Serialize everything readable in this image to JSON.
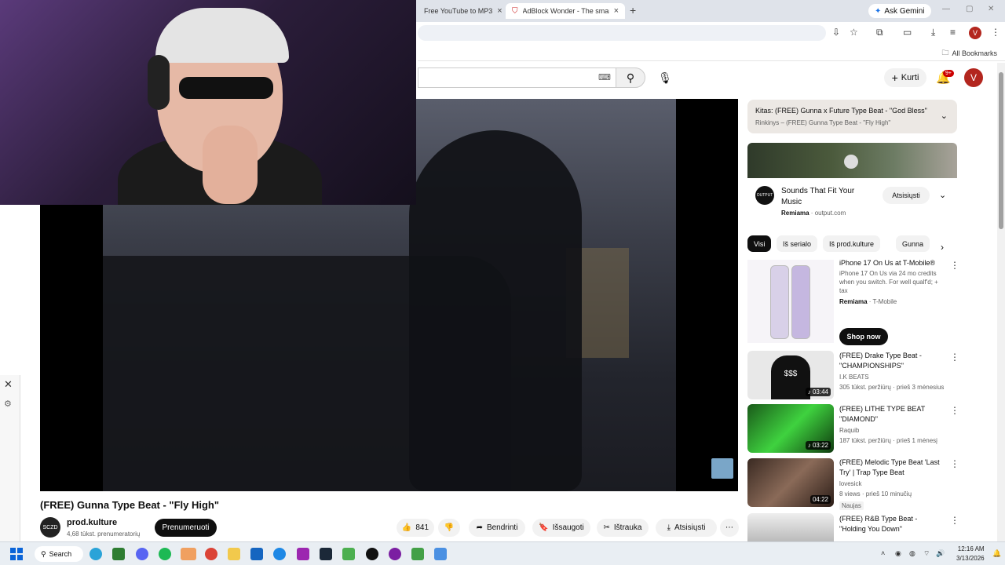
{
  "browser": {
    "tabs": [
      {
        "label": "Free YouTube to MP3"
      },
      {
        "label": "AdBlock Wonder - The smartest"
      }
    ],
    "ask_gemini": "Ask Gemini",
    "profile_initial": "V",
    "all_bookmarks": "All Bookmarks"
  },
  "yt_header": {
    "create_label": "Kurti",
    "notif_badge": "9+",
    "avatar_initial": "V"
  },
  "video": {
    "title": "(FREE) Gunna Type Beat - \"Fly High\"",
    "channel": "prod.kulture",
    "channel_avatar_text": "SCZD",
    "subscribers": "4,68 tūkst. prenumeratorių",
    "subscribe_label": "Prenumeruoti",
    "likes": "841",
    "share_label": "Bendrinti",
    "save_label": "Išsaugoti",
    "clip_label": "Ištrauka",
    "download_label": "Atsisiųsti"
  },
  "up_next": {
    "title": "Kitas: (FREE) Gunna x Future Type Beat - \"God Bless\"",
    "subtitle": "Rinkinys – (FREE) Gunna Type Beat - \"Fly High\""
  },
  "ad1": {
    "logo_text": "OUTPUT",
    "title": "Sounds That Fit Your Music",
    "sponsored": "Remiama",
    "domain": "output.com",
    "button": "Atsisiųsti"
  },
  "chips": [
    "Visi",
    "Iš serialo",
    "Iš prod.kulture",
    "Gunna"
  ],
  "ad2": {
    "title": "iPhone 17 On Us at T-Mobile®",
    "description": "iPhone 17 On Us via 24 mo credits when you switch. For well qualf'd; + tax",
    "sponsored": "Remiama",
    "advertiser": "T-Mobile",
    "button": "Shop now"
  },
  "recommendations": [
    {
      "title": "(FREE) Drake Type Beat - \"CHAMPIONSHIPS\"",
      "channel": "I.K BEATS",
      "meta": "305 tūkst. peržiūrų · prieš 3 mėnesius",
      "duration": "03:44",
      "thumb_text": "$$$"
    },
    {
      "title": "(FREE) LITHE TYPE BEAT \"DIAMOND\"",
      "channel": "Raquib",
      "meta": "187 tūkst. peržiūrų · prieš 1 mėnesį",
      "duration": "03:22"
    },
    {
      "title": "(FREE) Melodic Type Beat 'Last Try' | Trap Type Beat",
      "channel": "lovesick",
      "meta": "8 views · prieš 10 minučių",
      "duration": "04:22",
      "badge": "Naujas"
    },
    {
      "title": "(FREE) R&B Type Beat - \"Holding You Down\""
    }
  ],
  "taskbar": {
    "search_label": "Search",
    "time": "12:16 AM",
    "date": "3/13/2026"
  }
}
